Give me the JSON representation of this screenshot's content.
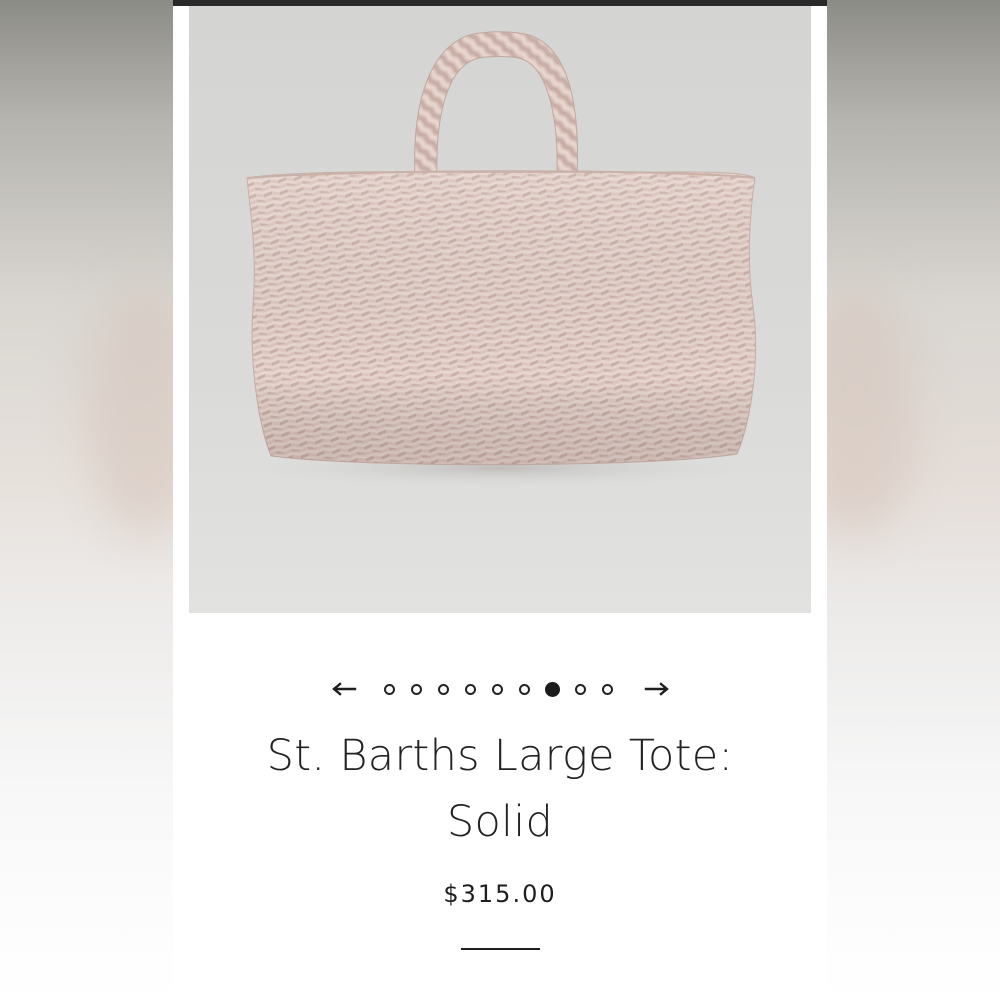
{
  "product": {
    "title": "St. Barths Large Tote: Solid",
    "price": "$315.00",
    "image_subject": "woven tote bag"
  },
  "carousel": {
    "prev_icon": "arrow-left-icon",
    "next_icon": "arrow-right-icon",
    "slide_count": 9,
    "active_index": 6
  },
  "colors": {
    "bag": "#dcc6bf",
    "image_bg": "#d8d8d6",
    "text": "#222222"
  }
}
